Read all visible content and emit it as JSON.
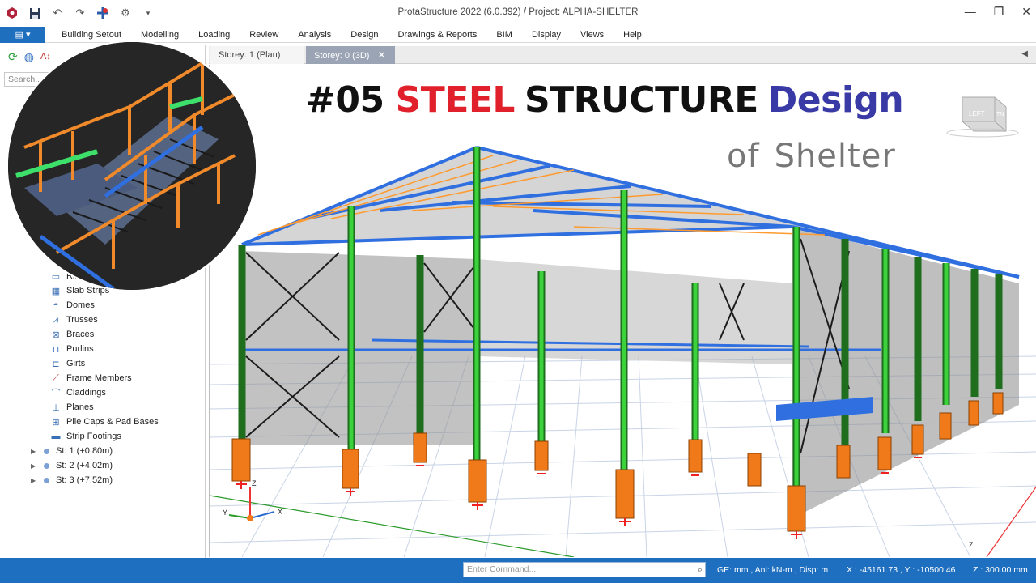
{
  "window": {
    "title": "ProtaStructure 2022 (6.0.392) / Project: ALPHA-SHELTER",
    "controls": [
      "minimize",
      "restore",
      "close"
    ]
  },
  "quick_access": {
    "icons": [
      "app-logo-icon",
      "save-icon",
      "undo-icon",
      "redo-icon",
      "pin-icon",
      "settings-icon",
      "dropdown-icon"
    ]
  },
  "ribbon": {
    "file_icon": "file-menu-icon",
    "tabs": [
      "Building Setout",
      "Modelling",
      "Loading",
      "Review",
      "Analysis",
      "Design",
      "Drawings & Reports",
      "BIM",
      "Display",
      "Views",
      "Help"
    ]
  },
  "left_panel": {
    "search_placeholder": "Search...",
    "members": [
      {
        "label": "Ribbed Slabs",
        "icon": "ribbed-slab-icon"
      },
      {
        "label": "Slab Strips",
        "icon": "slab-strip-icon"
      },
      {
        "label": "Domes",
        "icon": "dome-icon"
      },
      {
        "label": "Trusses",
        "icon": "truss-icon"
      },
      {
        "label": "Braces",
        "icon": "brace-icon"
      },
      {
        "label": "Purlins",
        "icon": "purlin-icon"
      },
      {
        "label": "Girts",
        "icon": "girt-icon"
      },
      {
        "label": "Frame Members",
        "icon": "frame-member-icon"
      },
      {
        "label": "Claddings",
        "icon": "cladding-icon"
      },
      {
        "label": "Planes",
        "icon": "plane-icon"
      },
      {
        "label": "Pile Caps & Pad Bases",
        "icon": "pile-cap-icon"
      },
      {
        "label": "Strip Footings",
        "icon": "strip-footing-icon"
      }
    ],
    "storeys": [
      "St: 1 (+0.80m)",
      "St: 2 (+4.02m)",
      "St: 3 (+7.52m)"
    ]
  },
  "document_tabs": [
    {
      "label": "Storey: 1 (Plan)",
      "active": false
    },
    {
      "label": "Storey: 0 (3D)",
      "active": true
    }
  ],
  "overlay": {
    "headline": [
      "#05",
      "STEEL",
      "STRUCTURE",
      "Design"
    ],
    "subline": [
      "of",
      "Shelter"
    ],
    "colors": {
      "headline_black": "#111111",
      "steel_red": "#e0202a",
      "design_blue": "#3a3aa6",
      "subline_gray": "#777777"
    }
  },
  "view_cube": {
    "label_left": "LEFT",
    "label_right": "TN"
  },
  "axis_triad": {
    "x": "X",
    "y": "Y",
    "z": "Z"
  },
  "corner_axis": {
    "z": "Z"
  },
  "status_bar": {
    "command_placeholder": "Enter Command...",
    "units": "GE: mm , Anl: kN-m , Disp: m",
    "coords": "X : -45161.73 , Y : -10500.46",
    "z": "Z : 300.00 mm",
    "bar_color": "#1e6fbf"
  },
  "model_colors": {
    "columns": "#3bd23b",
    "beams": "#2f6fe0",
    "purlins": "#ff9a2e",
    "pedestals": "#f07a1a",
    "supports": "#ee2222",
    "cladding": "#9a9a9a"
  }
}
